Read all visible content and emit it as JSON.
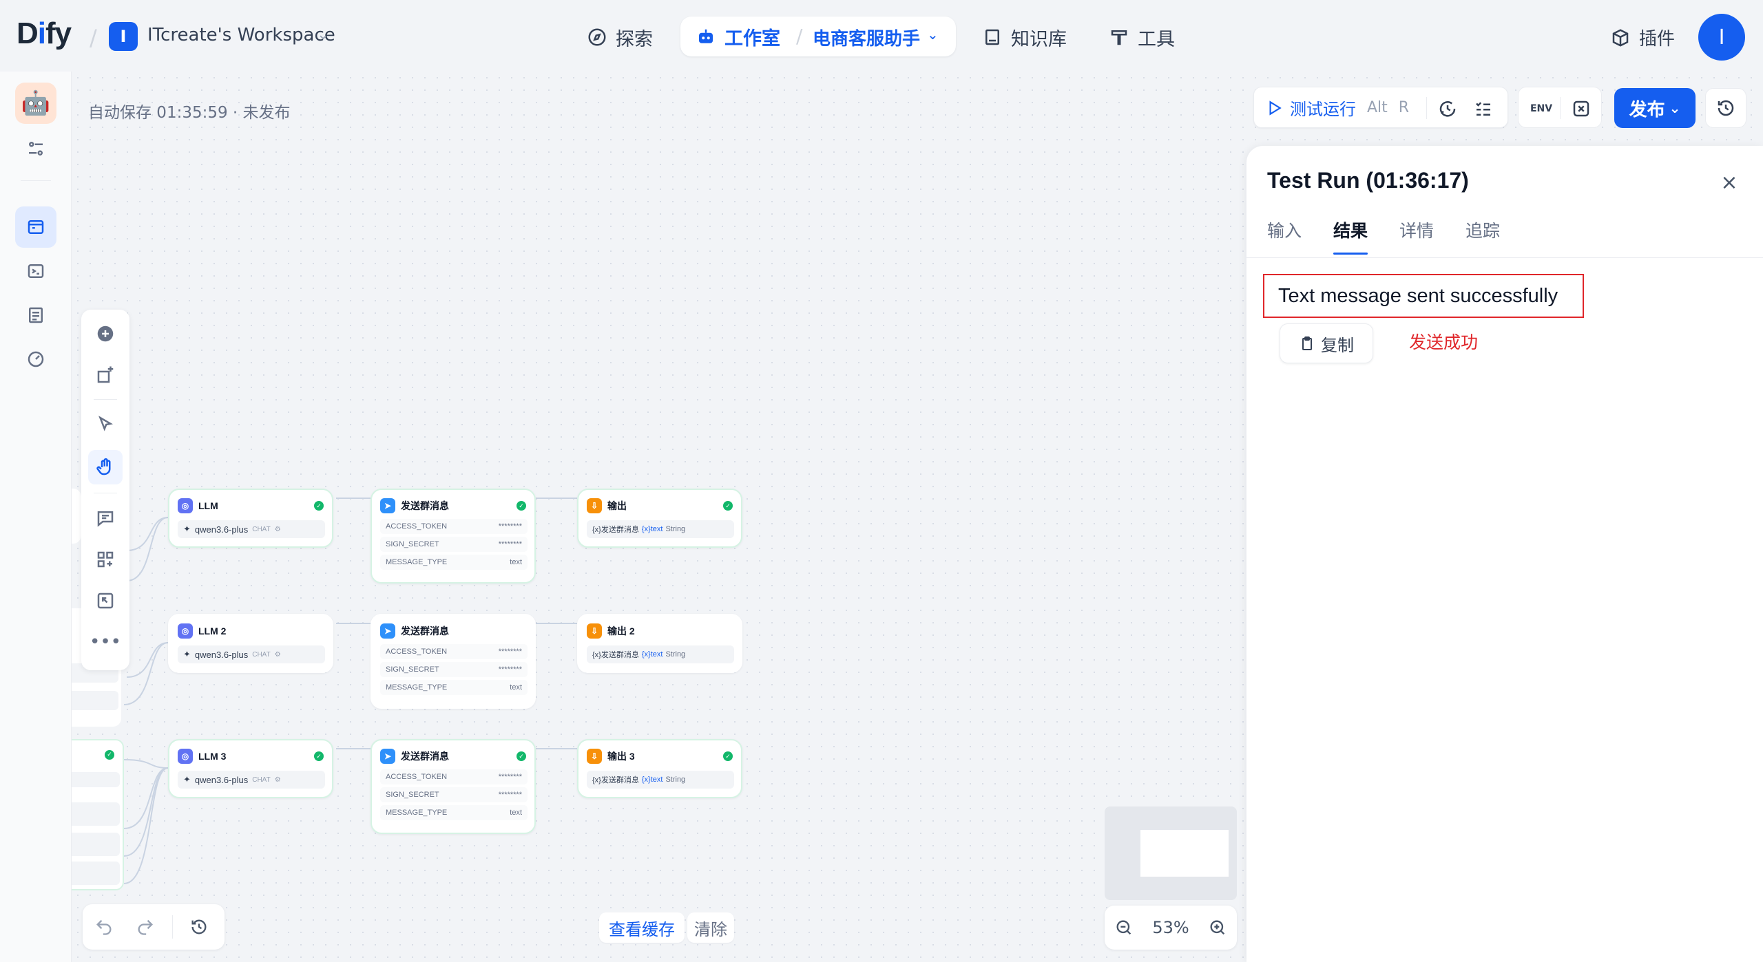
{
  "brand": {
    "logo_pre": "D",
    "logo_i": "i",
    "logo_post": "fy"
  },
  "workspace": {
    "badge": "I",
    "name": "ITcreate's Workspace"
  },
  "nav": {
    "explore": "探索",
    "studio": "工作室",
    "app_name": "电商客服助手",
    "knowledge": "知识库",
    "tools": "工具",
    "plugins": "插件"
  },
  "user": {
    "avatar_initial": "I"
  },
  "canvas": {
    "autosave": "自动保存 01:35:59 · 未发布",
    "view_cache": "查看缓存",
    "clear": "清除",
    "zoom": "53%"
  },
  "toolbar": {
    "test_run": "测试运行",
    "shortcut_1": "Alt",
    "shortcut_2": "R",
    "publish": "发布"
  },
  "nodes": [
    {
      "llm_title": "LLM",
      "send_title": "发送群消息",
      "out_title": "输出"
    },
    {
      "llm_title": "LLM 2",
      "send_title": "发送群消息",
      "out_title": "输出 2"
    },
    {
      "llm_title": "LLM 3",
      "send_title": "发送群消息",
      "out_title": "输出 3"
    }
  ],
  "node_fields": {
    "model": "qwen3.6-plus",
    "chat_tag": "CHAT",
    "access_token": "ACCESS_TOKEN",
    "sign_secret": "SIGN_SECRET",
    "message_type": "MESSAGE_TYPE",
    "mask": "********",
    "type_value": "text",
    "out_source": "{x}发送群消息",
    "out_var": "{x}text",
    "out_type": "String"
  },
  "panel": {
    "title": "Test Run (01:36:17)",
    "tabs": [
      "输入",
      "结果",
      "详情",
      "追踪"
    ],
    "active_tab": 1,
    "result_text": "Text message sent successfully",
    "copy": "复制",
    "note": "发送成功"
  },
  "colors": {
    "accent": "#155eef",
    "success": "#12b76a",
    "annotation": "#e0262a"
  }
}
